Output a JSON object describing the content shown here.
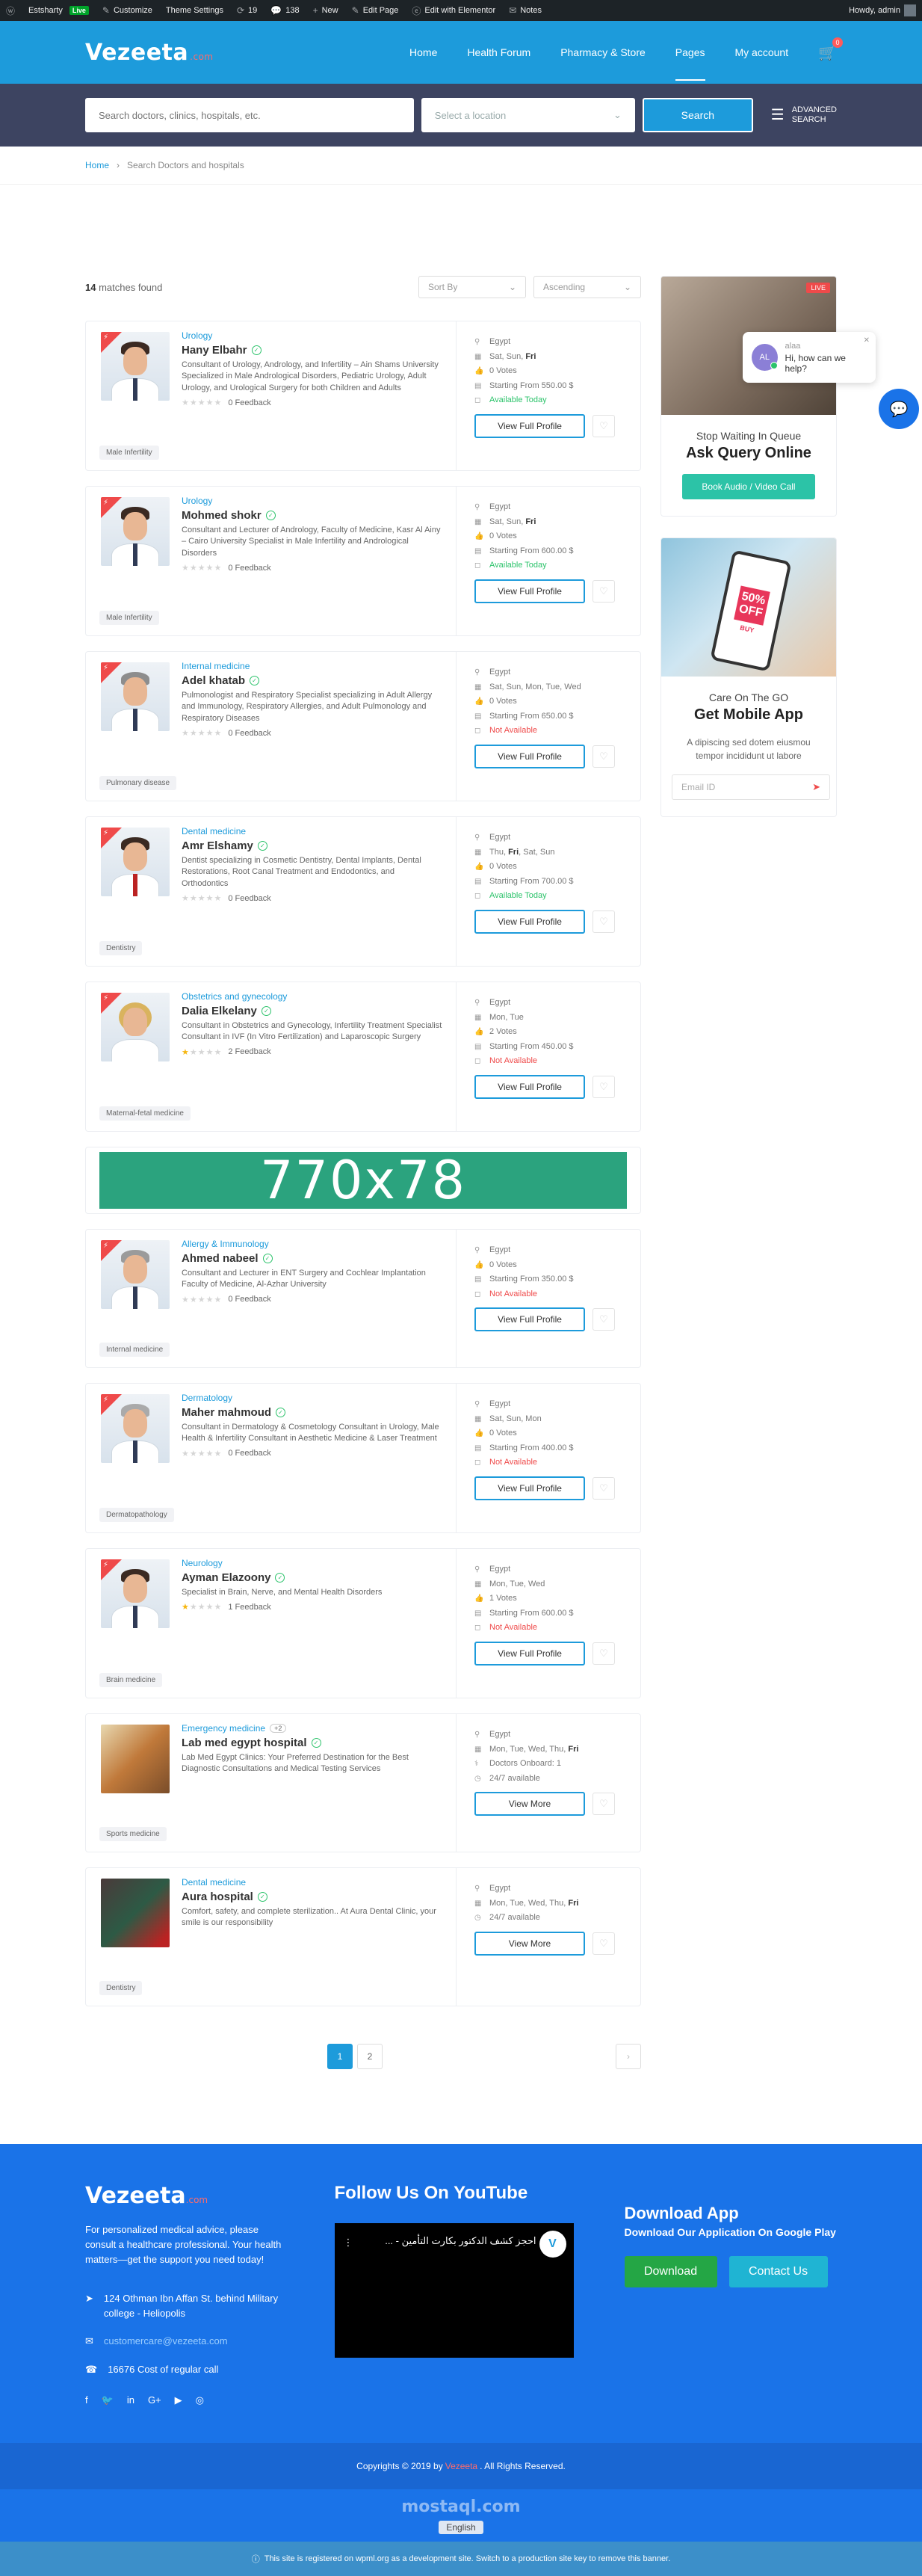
{
  "adminbar": {
    "site": "Estsharty",
    "live": "Live",
    "customize": "Customize",
    "theme_settings": "Theme Settings",
    "updates": "19",
    "comments": "138",
    "new": "New",
    "edit_page": "Edit Page",
    "elementor": "Edit with Elementor",
    "notes": "Notes",
    "howdy": "Howdy, admin"
  },
  "header": {
    "logo": "Vezeeta",
    "logo_suffix": ".com",
    "nav": [
      "Home",
      "Health Forum",
      "Pharmacy & Store",
      "Pages",
      "My account"
    ],
    "cart_count": "0"
  },
  "search": {
    "placeholder": "Search doctors, clinics, hospitals, etc.",
    "location_placeholder": "Select a location",
    "button": "Search",
    "advanced_line1": "ADVANCED",
    "advanced_line2": "SEARCH"
  },
  "breadcrumb": {
    "home": "Home",
    "current": "Search Doctors and hospitals"
  },
  "results": {
    "count": "14",
    "count_label": "matches found",
    "sort_by": "Sort By",
    "order": "Ascending"
  },
  "cards": [
    {
      "specialty": "Urology",
      "name": "Hany Elbahr",
      "desc": "Consultant of Urology, Andrology, and Infertility – Ain Shams University Specialized in Male Andrological Disorders, Pediatric Urology, Adult Urology, and Urological Surgery for both Children and Adults",
      "feedback": "0 Feedback",
      "tag": "Male Infertility",
      "country": "Egypt",
      "days": "Sat, Sun, ",
      "day_bold": "Fri",
      "votes": "0 Votes",
      "price": "Starting From 550.00 $",
      "availability": "Available Today",
      "button": "View Full Profile"
    },
    {
      "specialty": "Urology",
      "name": "Mohmed shokr",
      "desc": "Consultant and Lecturer of Andrology, Faculty of Medicine, Kasr Al Ainy – Cairo University Specialist in Male Infertility and Andrological Disorders",
      "feedback": "0 Feedback",
      "tag": "Male Infertility",
      "country": "Egypt",
      "days": "Sat, Sun, ",
      "day_bold": "Fri",
      "votes": "0 Votes",
      "price": "Starting From 600.00 $",
      "availability": "Available Today",
      "button": "View Full Profile"
    },
    {
      "specialty": "Internal medicine",
      "name": "Adel khatab",
      "desc": "Pulmonologist and Respiratory Specialist specializing in Adult Allergy and Immunology, Respiratory Allergies, and Adult Pulmonology and Respiratory Diseases",
      "feedback": "0 Feedback",
      "tag": "Pulmonary disease",
      "country": "Egypt",
      "days": "Sat, Sun, Mon, Tue, Wed",
      "day_bold": "",
      "votes": "0 Votes",
      "price": "Starting From 650.00 $",
      "availability": "Not Available",
      "button": "View Full Profile"
    },
    {
      "specialty": "Dental medicine",
      "name": "Amr Elshamy",
      "desc": "Dentist specializing in Cosmetic Dentistry, Dental Implants, Dental Restorations, Root Canal Treatment and Endodontics, and Orthodontics",
      "feedback": "0 Feedback",
      "tag": "Dentistry",
      "country": "Egypt",
      "days": "Thu, ",
      "day_bold": "Fri",
      "days_after": ", Sat, Sun",
      "votes": "0 Votes",
      "price": "Starting From 700.00 $",
      "availability": "Available Today",
      "button": "View Full Profile"
    },
    {
      "specialty": "Obstetrics and gynecology",
      "name": "Dalia Elkelany",
      "desc": "Consultant in Obstetrics and Gynecology, Infertility Treatment Specialist Consultant in IVF (In Vitro Fertilization) and Laparoscopic Surgery",
      "feedback": "2 Feedback",
      "tag": "Maternal-fetal medicine",
      "country": "Egypt",
      "days": "Mon, Tue",
      "day_bold": "",
      "votes": "2 Votes",
      "price": "Starting From 450.00 $",
      "availability": "Not Available",
      "button": "View Full Profile"
    }
  ],
  "ad": {
    "text": "770x78"
  },
  "cards2": [
    {
      "specialty": "Allergy & Immunology",
      "name": "Ahmed nabeel",
      "desc": "Consultant and Lecturer in ENT Surgery and Cochlear Implantation Faculty of Medicine, Al-Azhar University",
      "feedback": "0 Feedback",
      "tag": "Internal medicine",
      "country": "Egypt",
      "votes": "0 Votes",
      "price": "Starting From 350.00 $",
      "availability": "Not Available",
      "button": "View Full Profile"
    },
    {
      "specialty": "Dermatology",
      "name": "Maher mahmoud",
      "desc": "Consultant in Dermatology & Cosmetology Consultant in Urology, Male Health & Infertility Consultant in Aesthetic Medicine & Laser Treatment",
      "feedback": "0 Feedback",
      "tag": "Dermatopathology",
      "country": "Egypt",
      "days": "Sat, Sun, Mon",
      "votes": "0 Votes",
      "price": "Starting From 400.00 $",
      "availability": "Not Available",
      "button": "View Full Profile"
    },
    {
      "specialty": "Neurology",
      "name": "Ayman Elazoony",
      "desc": "Specialist in Brain, Nerve, and Mental Health Disorders",
      "feedback": "1 Feedback",
      "tag": "Brain medicine",
      "country": "Egypt",
      "days": "Mon, Tue, Wed",
      "votes": "1 Votes",
      "price": "Starting From 600.00 $",
      "availability": "Not Available",
      "button": "View Full Profile"
    },
    {
      "specialty": "Emergency medicine",
      "plus": "+2",
      "name": "Lab med egypt hospital",
      "desc": "Lab Med Egypt Clinics: Your Preferred Destination for the Best Diagnostic Consultations and Medical Testing Services",
      "tag": "Sports medicine",
      "country": "Egypt",
      "days": "Mon, Tue, Wed, Thu, ",
      "day_bold": "Fri",
      "doctors": "Doctors Onboard: 1",
      "hours": "24/7 available",
      "button": "View More"
    },
    {
      "specialty": "Dental medicine",
      "name": "Aura hospital",
      "desc": "Comfort, safety, and complete sterilization.. At Aura Dental Clinic, your smile is our responsibility",
      "tag": "Dentistry",
      "country": "Egypt",
      "days": "Mon, Tue, Wed, Thu, ",
      "day_bold": "Fri",
      "hours": "24/7 available",
      "button": "View More"
    }
  ],
  "pagination": {
    "p1": "1",
    "p2": "2",
    "next": "›"
  },
  "sidebar": {
    "live": "LIVE",
    "queue_sub": "Stop Waiting In Queue",
    "queue_title": "Ask Query Online",
    "book_btn": "Book Audio / Video Call",
    "promo_off1": "50%",
    "promo_off2": "OFF",
    "promo_buy": "BUY",
    "app_sub": "Care On The GO",
    "app_title": "Get Mobile App",
    "app_desc": "A dipiscing sed dotem eiusmou tempor incididunt ut labore",
    "email_placeholder": "Email ID"
  },
  "chat": {
    "initials": "AL",
    "name": "alaa",
    "message": "Hi, how can we help?"
  },
  "footer": {
    "logo": "Vezeeta",
    "logo_suffix": ".com",
    "text": "For personalized medical advice, please consult a healthcare professional. Your health matters—get the support you need today!",
    "address": "124 Othman Ibn Affan St. behind Military college - Heliopolis",
    "email": "customercare@vezeeta.com",
    "phone": "16676 Cost of regular call",
    "youtube_heading": "Follow Us On YouTube",
    "video_title": "احجز كشف الدكتور بكارت التأمين - ...",
    "video_logo": "V",
    "app_heading": "Download App",
    "app_sub": "Download Our Application On Google Play",
    "download_btn": "Download",
    "contact_btn": "Contact Us"
  },
  "copyright": {
    "pre": "Copyrights © 2019 by",
    "brand": "Vezeeta",
    "post": ". All Rights Reserved."
  },
  "language": "English",
  "watermark": "mostaql.com",
  "notice": "This site is registered on wpml.org as a development site. Switch to a production site key to remove this banner.",
  "colors": {
    "primary": "#1d9bdb",
    "footer": "#1a73e8",
    "searchbar": "#3d4461",
    "available": "#2cc36b",
    "unavailable": "#ef4a4a"
  }
}
